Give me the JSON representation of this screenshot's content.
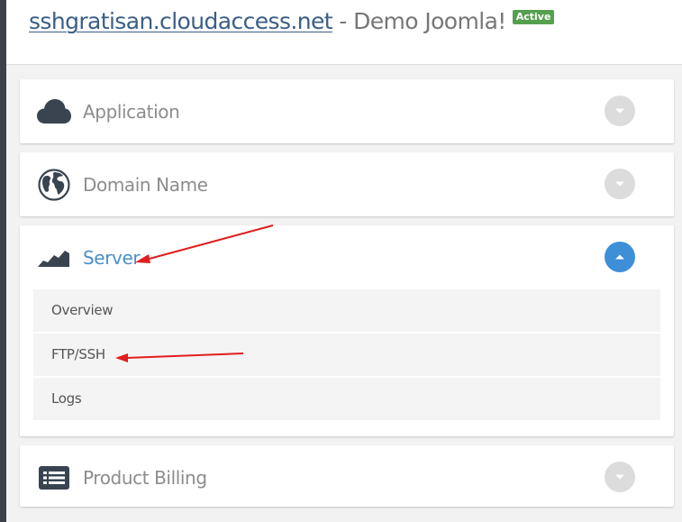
{
  "header": {
    "site_link": "sshgratisan.cloudaccess.net",
    "separator": " - ",
    "site_name": "Demo Joomla!",
    "status_badge": "Active"
  },
  "panels": [
    {
      "label": "Application",
      "icon": "cloud-icon",
      "expanded": false
    },
    {
      "label": "Domain Name",
      "icon": "globe-icon",
      "expanded": false
    },
    {
      "label": "Server",
      "icon": "server-graph-icon",
      "expanded": true,
      "items": [
        {
          "label": "Overview"
        },
        {
          "label": "FTP/SSH"
        },
        {
          "label": "Logs"
        }
      ]
    },
    {
      "label": "Product Billing",
      "icon": "billing-list-icon",
      "expanded": false
    }
  ],
  "colors": {
    "link": "#3b5e86",
    "active_label": "#4a90c8",
    "toggle_open": "#3d8fd8",
    "toggle_closed": "#dcdcdc",
    "badge": "#55a04f",
    "annotation_arrow": "#e01e1e"
  }
}
